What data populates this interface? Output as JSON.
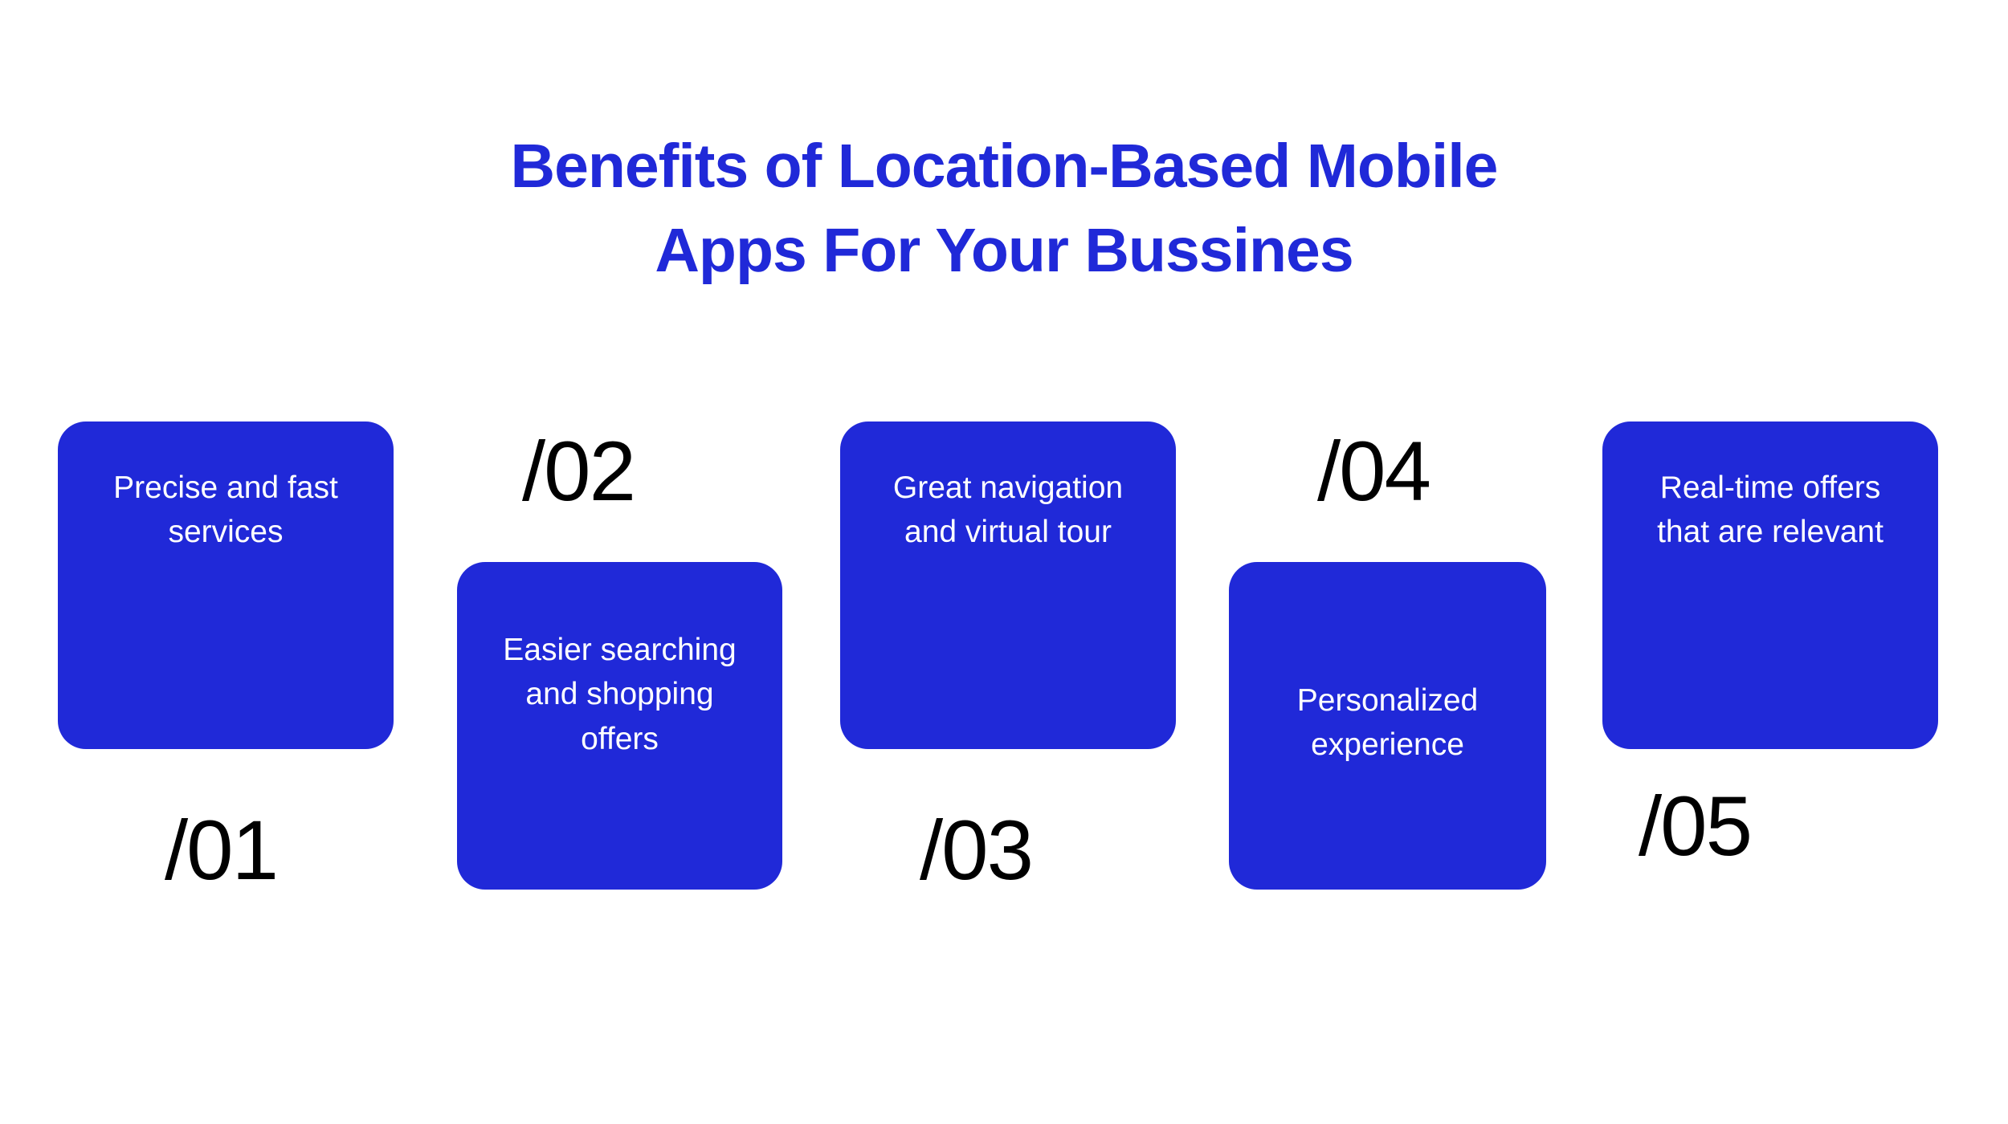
{
  "title": "Benefits of Location-Based Mobile Apps For Your Bussines",
  "cards": {
    "c1": "Precise and fast services",
    "c2": "Easier searching and shopping offers",
    "c3": "Great navigation and virtual tour",
    "c4": "Personalized experience",
    "c5": "Real-time offers that are relevant"
  },
  "numbers": {
    "n1": "/01",
    "n2": "/02",
    "n3": "/03",
    "n4": "/04",
    "n5": "/05"
  }
}
